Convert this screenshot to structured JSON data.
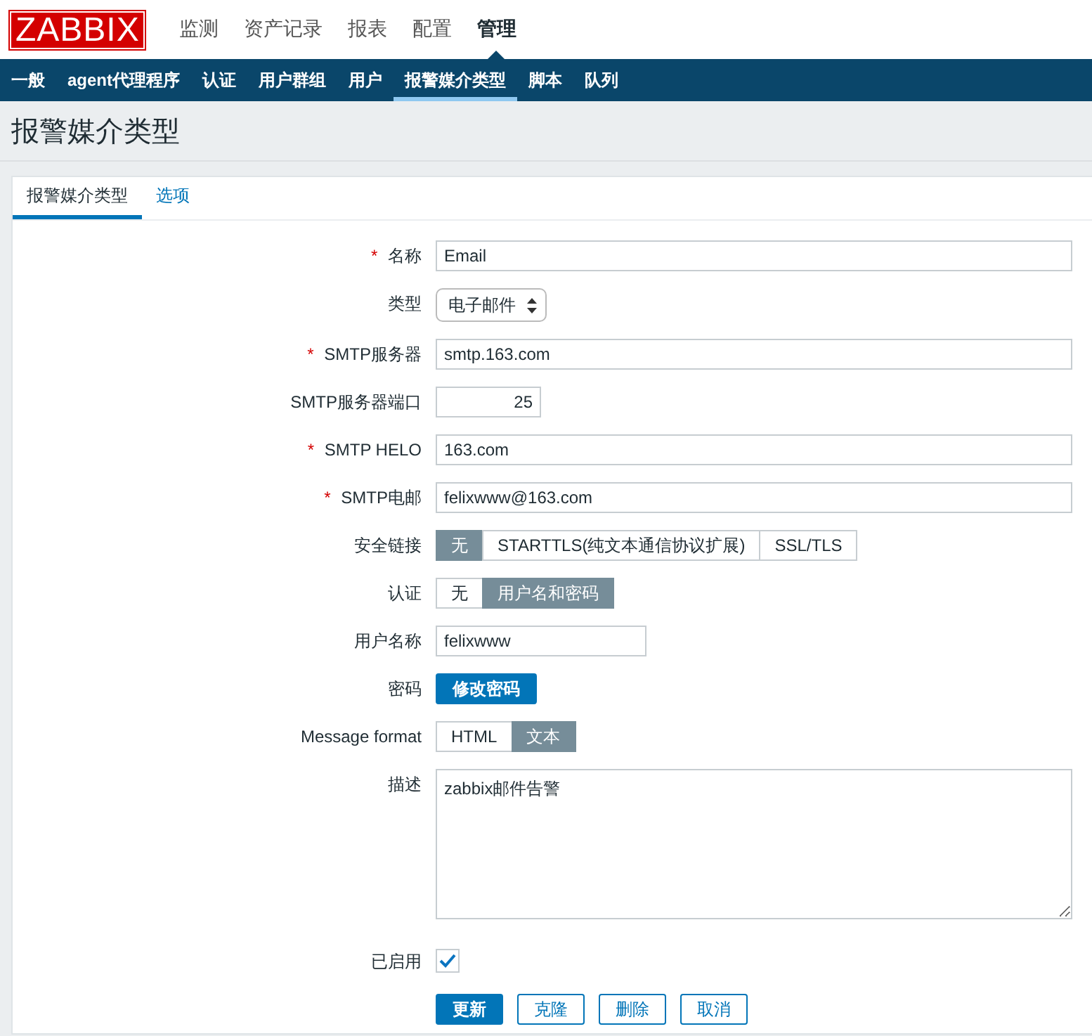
{
  "logo": "ZABBIX",
  "main_menu": [
    {
      "label": "监测",
      "selected": false
    },
    {
      "label": "资产记录",
      "selected": false
    },
    {
      "label": "报表",
      "selected": false
    },
    {
      "label": "配置",
      "selected": false
    },
    {
      "label": "管理",
      "selected": true
    }
  ],
  "sub_menu": [
    {
      "label": "一般",
      "selected": false
    },
    {
      "label": "agent代理程序",
      "selected": false
    },
    {
      "label": "认证",
      "selected": false
    },
    {
      "label": "用户群组",
      "selected": false
    },
    {
      "label": "用户",
      "selected": false
    },
    {
      "label": "报警媒介类型",
      "selected": true
    },
    {
      "label": "脚本",
      "selected": false
    },
    {
      "label": "队列",
      "selected": false
    }
  ],
  "page_title": "报警媒介类型",
  "tabs": [
    {
      "label": "报警媒介类型",
      "selected": true
    },
    {
      "label": "选项",
      "selected": false
    }
  ],
  "form": [
    {
      "kind": "text",
      "marker": "*",
      "label": "名称",
      "value": "Email"
    },
    {
      "kind": "select",
      "label": "类型",
      "value": "电子邮件"
    },
    {
      "kind": "text",
      "marker": "*",
      "label": "SMTP服务器",
      "value": "smtp.163.com"
    },
    {
      "kind": "number",
      "label": "SMTP服务器端口",
      "value": "25"
    },
    {
      "kind": "text",
      "marker": "*",
      "label": "SMTP HELO",
      "value": "163.com"
    },
    {
      "kind": "text",
      "marker": "*",
      "label": "SMTP电邮",
      "value": "felixwww@163.com"
    },
    {
      "kind": "segmented",
      "label": "安全链接",
      "options": [
        {
          "label": "无",
          "selected": true
        },
        {
          "label": "STARTTLS(纯文本通信协议扩展)",
          "selected": false
        },
        {
          "label": "SSL/TLS",
          "selected": false
        }
      ]
    },
    {
      "kind": "segmented",
      "label": "认证",
      "options": [
        {
          "label": "无",
          "selected": false
        },
        {
          "label": "用户名和密码",
          "selected": true
        }
      ]
    },
    {
      "kind": "short_text",
      "label": "用户名称",
      "value": "felixwww"
    },
    {
      "kind": "button",
      "label": "密码",
      "button": "修改密码"
    },
    {
      "kind": "segmented",
      "label": "Message format",
      "options": [
        {
          "label": "HTML",
          "selected": false
        },
        {
          "label": "文本",
          "selected": true
        }
      ]
    },
    {
      "kind": "textarea",
      "label": "描述",
      "value": "zabbix邮件告警"
    },
    {
      "kind": "checkbox",
      "label": "已启用",
      "checked": true
    }
  ],
  "actions": [
    {
      "label": "更新",
      "primary": true
    },
    {
      "label": "克隆",
      "primary": false
    },
    {
      "label": "删除",
      "primary": false
    },
    {
      "label": "取消",
      "primary": false
    }
  ]
}
